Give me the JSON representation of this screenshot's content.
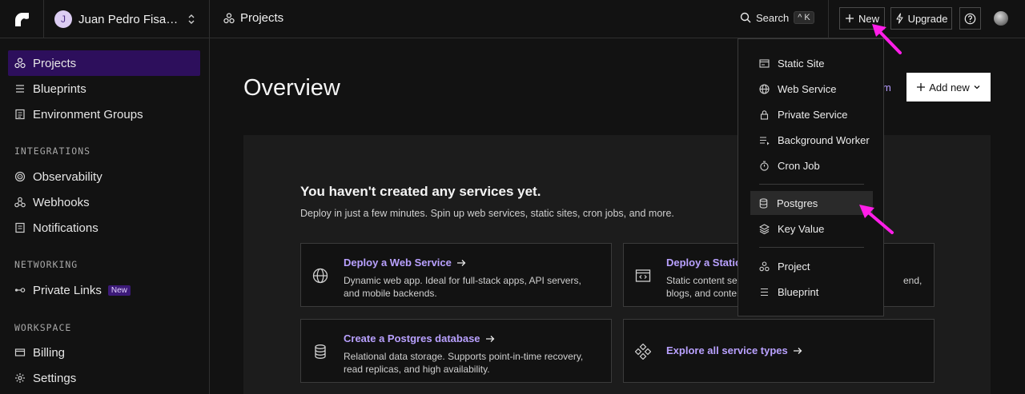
{
  "topbar": {
    "workspace_initial": "J",
    "workspace_name": "Juan Pedro Fisanotti",
    "breadcrumb": "Projects",
    "search_label": "Search",
    "search_shortcut": "^ K",
    "new_label": "New",
    "upgrade_label": "Upgrade",
    "help_icon": "question-circle-icon"
  },
  "sidebar": {
    "items": [
      {
        "label": "Projects",
        "icon": "projects-icon",
        "active": true
      },
      {
        "label": "Blueprints",
        "icon": "blueprint-icon"
      },
      {
        "label": "Environment Groups",
        "icon": "env-groups-icon"
      }
    ],
    "integrations_heading": "INTEGRATIONS",
    "integrations": [
      {
        "label": "Observability",
        "icon": "observability-icon"
      },
      {
        "label": "Webhooks",
        "icon": "webhooks-icon"
      },
      {
        "label": "Notifications",
        "icon": "notifications-icon"
      }
    ],
    "networking_heading": "NETWORKING",
    "networking": [
      {
        "label": "Private Links",
        "icon": "private-links-icon",
        "badge": "New"
      }
    ],
    "workspace_heading": "WORKSPACE",
    "workspace": [
      {
        "label": "Billing",
        "icon": "billing-icon"
      },
      {
        "label": "Settings",
        "icon": "settings-icon"
      }
    ]
  },
  "main": {
    "title": "Overview",
    "team_link_fragment": "m",
    "add_new_label": "Add new",
    "empty_heading": "You haven't created any services yet.",
    "empty_text": "Deploy in just a few minutes. Spin up web services, static sites, cron jobs, and more.",
    "cards": [
      {
        "title": "Deploy a Web Service",
        "desc": "Dynamic web app. Ideal for full-stack apps, API servers, and mobile backends.",
        "icon": "globe-icon"
      },
      {
        "title": "Deploy a Static",
        "desc_line1": "Static content ser",
        "desc_line1_end": "end,",
        "desc_line2": "blogs, and conten",
        "icon": "static-site-icon"
      },
      {
        "title": "Create a Postgres database",
        "desc": "Relational data storage. Supports point-in-time recovery, read replicas, and high availability.",
        "icon": "database-icon"
      },
      {
        "title": "Explore all service types",
        "icon": "service-types-icon"
      }
    ]
  },
  "new_menu": {
    "items": [
      {
        "label": "Static Site",
        "icon": "static-site-icon"
      },
      {
        "label": "Web Service",
        "icon": "globe-icon"
      },
      {
        "label": "Private Service",
        "icon": "lock-icon"
      },
      {
        "label": "Background Worker",
        "icon": "worker-icon"
      },
      {
        "label": "Cron Job",
        "icon": "stopwatch-icon"
      },
      {
        "label": "Postgres",
        "icon": "database-icon",
        "highlighted": true
      },
      {
        "label": "Key Value",
        "icon": "layers-icon"
      },
      {
        "label": "Project",
        "icon": "projects-icon"
      },
      {
        "label": "Blueprint",
        "icon": "blueprint-icon"
      }
    ]
  },
  "colors": {
    "background": "#121212",
    "active_nav": "#2d0f5c",
    "accent_link": "#b9a1ff",
    "annotation_arrow": "#ff1ee8"
  }
}
